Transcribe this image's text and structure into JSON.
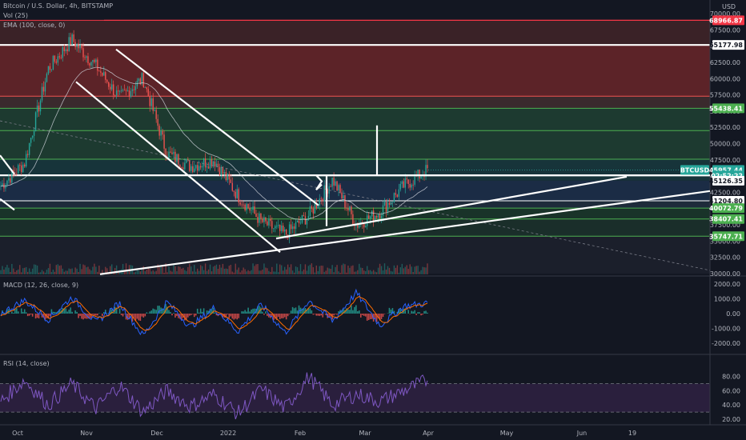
{
  "legend": {
    "title": "Bitcoin / U.S. Dollar, 4h, BITSTAMP",
    "vol": "Vol (25)",
    "ema": "EMA (100, close, 0)",
    "macd": "MACD (12, 26, close, 9)",
    "rsi": "RSI (14, close)"
  },
  "currency": "USD",
  "price_axis": {
    "ticks": [
      "70000.00",
      "67500.00",
      "65000.00",
      "62500.00",
      "60000.00",
      "57500.00",
      "55000.00",
      "52500.00",
      "50000.00",
      "47500.00",
      "45000.00",
      "42500.00",
      "40000.00",
      "37500.00",
      "35000.00",
      "32500.00",
      "30000.00"
    ],
    "tick_values": [
      70000,
      67500,
      65000,
      62500,
      60000,
      57500,
      55000,
      52500,
      50000,
      47500,
      45000,
      42500,
      40000,
      37500,
      35000,
      32500,
      30000
    ]
  },
  "price_labels": [
    {
      "text": "68966.87",
      "value": 68966.87,
      "bg": "#f23645"
    },
    {
      "text": "65177.98",
      "value": 65177.98,
      "bg": "#ffffff"
    },
    {
      "text": "55438.41",
      "value": 55438.41,
      "bg": "#4caf50"
    },
    {
      "text": "45957.44",
      "value": 45957.44,
      "bg": "#26a69a"
    },
    {
      "text": "02:52:22",
      "value": 45100,
      "bg": "#26a69a"
    },
    {
      "text": "45126.35",
      "value": 44300,
      "bg": "#ffffff"
    },
    {
      "text": "41204.80",
      "value": 41204.8,
      "bg": "#ffffff"
    },
    {
      "text": "40072.79",
      "value": 40072.79,
      "bg": "#4caf50"
    },
    {
      "text": "38407.41",
      "value": 38407.41,
      "bg": "#4caf50"
    },
    {
      "text": "35747.71",
      "value": 35747.71,
      "bg": "#4caf50"
    }
  ],
  "symbol_tag": "BTCUSD",
  "macd_axis": {
    "ticks": [
      "2000.00",
      "1000.00",
      "0.00",
      "-1000.00",
      "-2000.00"
    ],
    "tick_values": [
      2000,
      1000,
      0,
      -1000,
      -2000
    ]
  },
  "rsi_axis": {
    "ticks": [
      "80.00",
      "60.00",
      "40.00",
      "20.00"
    ],
    "tick_values": [
      80,
      60,
      40,
      20
    ]
  },
  "time_axis": [
    "Oct",
    "Nov",
    "Dec",
    "2022",
    "Feb",
    "Mar",
    "Apr",
    "May",
    "Jun",
    "19"
  ],
  "colors": {
    "up": "#26a69a",
    "down": "#ef5350",
    "macd": "#2962ff",
    "signal": "#ff6d00",
    "rsi": "#7e57c2",
    "background": "#131722"
  },
  "chart_data": [
    {
      "type": "line",
      "title": "Bitcoin / U.S. Dollar, 4h, BITSTAMP",
      "ylabel": "USD",
      "ylim": [
        30000,
        70000
      ],
      "x": [
        "Oct",
        "Nov",
        "Dec",
        "2022",
        "Feb",
        "Mar",
        "Apr",
        "May",
        "Jun",
        "19"
      ],
      "horizontal_levels": [
        68966.87,
        65177.98,
        55438.41,
        45126.35,
        41204.8,
        40072.79,
        38407.41,
        35747.71
      ],
      "series": [
        {
          "name": "",
          "values": [
            43500,
            47000,
            61500,
            66000,
            62000,
            57000,
            60000,
            48500,
            46500,
            47500,
            42000,
            38000,
            36000,
            39000,
            44500,
            37500,
            39500,
            43500,
            45957
          ]
        }
      ]
    },
    {
      "type": "line",
      "title": "MACD (12, 26, close, 9)",
      "ylim": [
        -2500,
        2500
      ],
      "series": [
        {
          "name": "",
          "values": [
            0,
            900,
            -400,
            1100,
            -600,
            700,
            -1500,
            800,
            -900,
            400,
            -1200,
            600,
            -1300,
            900,
            -500,
            1400,
            -800,
            500,
            700
          ]
        }
      ]
    },
    {
      "type": "line",
      "title": "RSI (14, close)",
      "ylim": [
        15,
        90
      ],
      "series": [
        {
          "name": "",
          "values": [
            45,
            75,
            40,
            70,
            35,
            68,
            30,
            60,
            38,
            55,
            28,
            62,
            35,
            80,
            40,
            55,
            45,
            60,
            75
          ]
        }
      ]
    }
  ]
}
